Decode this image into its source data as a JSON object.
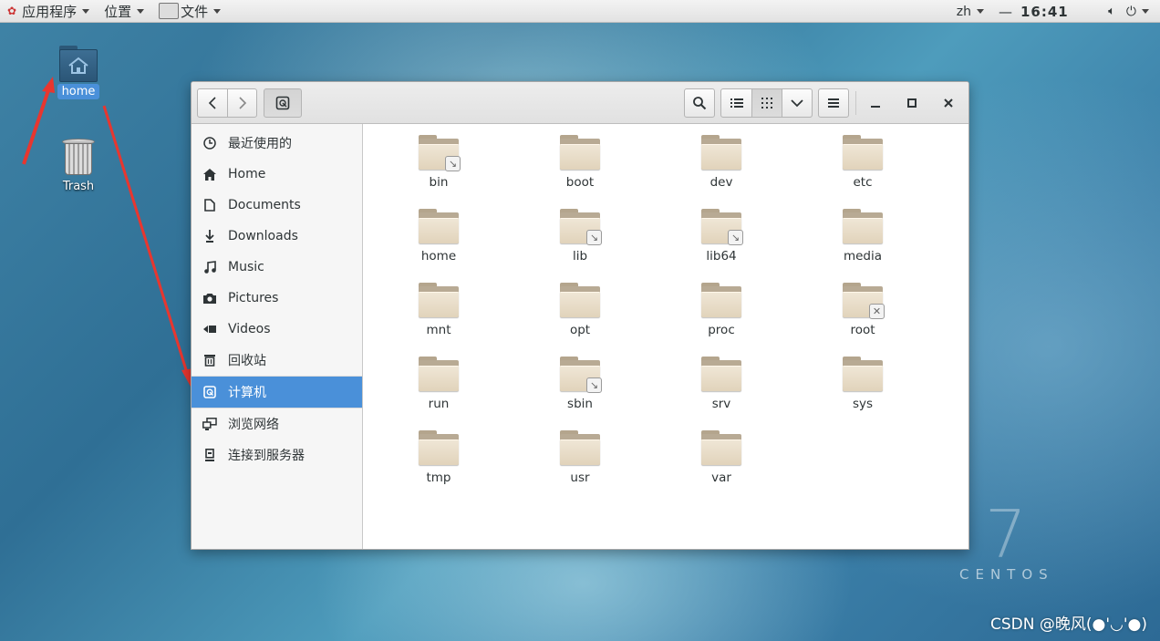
{
  "topbar": {
    "applications": "应用程序",
    "places": "位置",
    "file_menu": "文件",
    "lang": "zh",
    "time": "16:41"
  },
  "desktop": {
    "icons": [
      {
        "label": "home",
        "icon": "home-folder-icon"
      },
      {
        "label": "Trash",
        "icon": "trash-icon"
      }
    ]
  },
  "sidebar": {
    "items": [
      {
        "label": "最近使用的",
        "icon": "clock-icon"
      },
      {
        "label": "Home",
        "icon": "home-icon"
      },
      {
        "label": "Documents",
        "icon": "document-icon"
      },
      {
        "label": "Downloads",
        "icon": "download-icon"
      },
      {
        "label": "Music",
        "icon": "music-icon"
      },
      {
        "label": "Pictures",
        "icon": "camera-icon"
      },
      {
        "label": "Videos",
        "icon": "video-icon"
      },
      {
        "label": "回收站",
        "icon": "trash-icon"
      },
      {
        "label": "计算机",
        "icon": "drive-icon",
        "active": true
      },
      {
        "label": "浏览网络",
        "icon": "network-icon"
      },
      {
        "label": "连接到服务器",
        "icon": "server-icon"
      }
    ]
  },
  "files": [
    {
      "name": "bin",
      "emblem": "link"
    },
    {
      "name": "boot",
      "emblem": ""
    },
    {
      "name": "dev",
      "emblem": ""
    },
    {
      "name": "etc",
      "emblem": ""
    },
    {
      "name": "home",
      "emblem": ""
    },
    {
      "name": "lib",
      "emblem": "link"
    },
    {
      "name": "lib64",
      "emblem": "link"
    },
    {
      "name": "media",
      "emblem": ""
    },
    {
      "name": "mnt",
      "emblem": ""
    },
    {
      "name": "opt",
      "emblem": ""
    },
    {
      "name": "proc",
      "emblem": ""
    },
    {
      "name": "root",
      "emblem": "locked"
    },
    {
      "name": "run",
      "emblem": ""
    },
    {
      "name": "sbin",
      "emblem": "link"
    },
    {
      "name": "srv",
      "emblem": ""
    },
    {
      "name": "sys",
      "emblem": ""
    },
    {
      "name": "tmp",
      "emblem": ""
    },
    {
      "name": "usr",
      "emblem": ""
    },
    {
      "name": "var",
      "emblem": ""
    }
  ],
  "branding": {
    "version": "7",
    "name": "CENTOS"
  },
  "watermark": "CSDN @晚风(●'◡'●)"
}
